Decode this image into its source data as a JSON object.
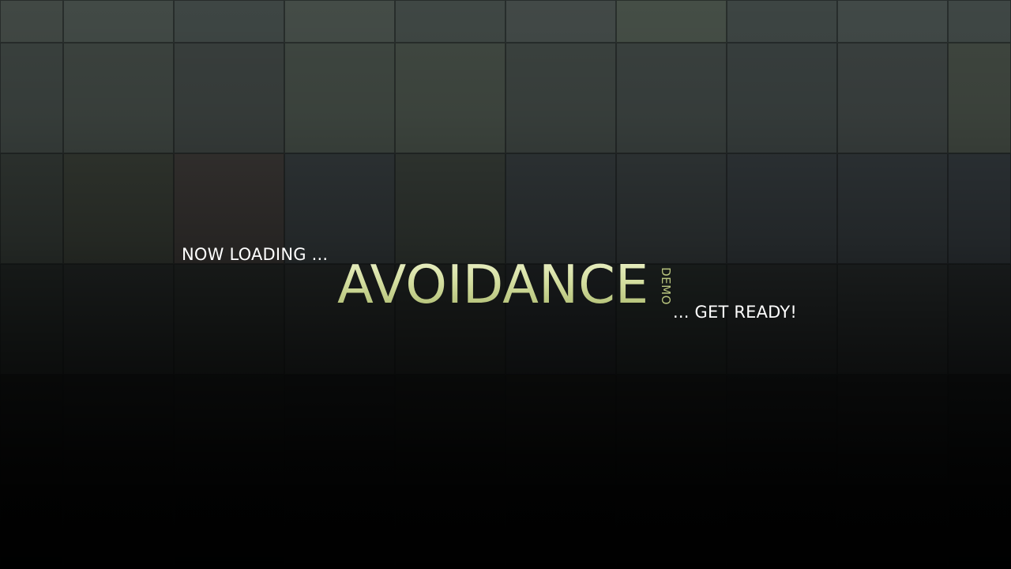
{
  "loading_screen": {
    "loading_text": "NOW LOADING ...",
    "title": "AVOIDANCE",
    "title_tag": "DEMO",
    "ready_text": "... GET READY!"
  },
  "colors": {
    "background_top": "#414944",
    "background_bottom": "#000000",
    "title_accent": "#c6d18e",
    "message_text": "#ffffff"
  }
}
